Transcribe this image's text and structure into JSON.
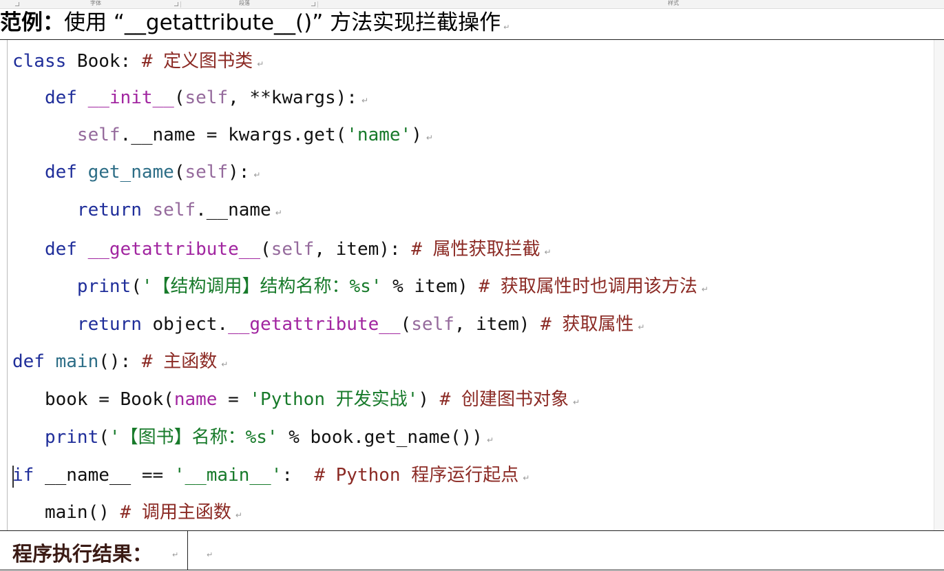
{
  "ribbon": {
    "group_font": "字体",
    "group_paragraph": "段落",
    "group_styles": "样式"
  },
  "heading": {
    "label": "范例",
    "colon": "：",
    "text": "使用 “__getattribute__()” 方法实现拦截操作"
  },
  "paragraph_mark": "↵",
  "code_lines": [
    [
      {
        "t": "class",
        "c": "kw"
      },
      {
        "t": " Book: "
      },
      {
        "t": "# ",
        "c": "cm"
      },
      {
        "t": "定义图书类",
        "c": "cm cn"
      }
    ],
    [
      {
        "t": "   "
      },
      {
        "t": "def",
        "c": "kw"
      },
      {
        "t": " "
      },
      {
        "t": "__init__",
        "c": "dunder"
      },
      {
        "t": "("
      },
      {
        "t": "self",
        "c": "slf"
      },
      {
        "t": ", **kwargs):"
      }
    ],
    [
      {
        "t": "      "
      },
      {
        "t": "self",
        "c": "slf"
      },
      {
        "t": ".__name = kwargs.get("
      },
      {
        "t": "'name'",
        "c": "str"
      },
      {
        "t": ")"
      }
    ],
    [
      {
        "t": "   "
      },
      {
        "t": "def",
        "c": "kw"
      },
      {
        "t": " "
      },
      {
        "t": "get_name",
        "c": "fn"
      },
      {
        "t": "("
      },
      {
        "t": "self",
        "c": "slf"
      },
      {
        "t": "):"
      }
    ],
    [
      {
        "t": "      "
      },
      {
        "t": "return",
        "c": "kw"
      },
      {
        "t": " "
      },
      {
        "t": "self",
        "c": "slf"
      },
      {
        "t": ".__name"
      }
    ],
    [
      {
        "t": "   "
      },
      {
        "t": "def",
        "c": "kw"
      },
      {
        "t": " "
      },
      {
        "t": "__getattribute__",
        "c": "dunder"
      },
      {
        "t": "("
      },
      {
        "t": "self",
        "c": "slf"
      },
      {
        "t": ", item): "
      },
      {
        "t": "# ",
        "c": "cm"
      },
      {
        "t": "属性获取拦截",
        "c": "cm cn"
      }
    ],
    [
      {
        "t": "      "
      },
      {
        "t": "print",
        "c": "kw"
      },
      {
        "t": "("
      },
      {
        "t": "'",
        "c": "str"
      },
      {
        "t": "【结构调用】结构名称：",
        "c": "str cn"
      },
      {
        "t": "%s'",
        "c": "str"
      },
      {
        "t": " % item) "
      },
      {
        "t": "# ",
        "c": "cm"
      },
      {
        "t": "获取属性时也调用该方法",
        "c": "cm cn"
      }
    ],
    [
      {
        "t": "      "
      },
      {
        "t": "return",
        "c": "kw"
      },
      {
        "t": " object."
      },
      {
        "t": "__getattribute__",
        "c": "dunder"
      },
      {
        "t": "("
      },
      {
        "t": "self",
        "c": "slf"
      },
      {
        "t": ", item) "
      },
      {
        "t": "# ",
        "c": "cm"
      },
      {
        "t": "获取属性",
        "c": "cm cn"
      }
    ],
    [
      {
        "t": "def",
        "c": "kw"
      },
      {
        "t": " "
      },
      {
        "t": "main",
        "c": "fn"
      },
      {
        "t": "(): "
      },
      {
        "t": "# ",
        "c": "cm"
      },
      {
        "t": "主函数",
        "c": "cm cn"
      }
    ],
    [
      {
        "t": "   book = Book("
      },
      {
        "t": "name",
        "c": "dunder"
      },
      {
        "t": " = "
      },
      {
        "t": "'Python ",
        "c": "str"
      },
      {
        "t": "开发实战",
        "c": "str cn"
      },
      {
        "t": "'",
        "c": "str"
      },
      {
        "t": ") "
      },
      {
        "t": "# ",
        "c": "cm"
      },
      {
        "t": "创建图书对象",
        "c": "cm cn"
      }
    ],
    [
      {
        "t": "   "
      },
      {
        "t": "print",
        "c": "kw"
      },
      {
        "t": "("
      },
      {
        "t": "'",
        "c": "str"
      },
      {
        "t": "【图书】名称：",
        "c": "str cn"
      },
      {
        "t": "%s'",
        "c": "str"
      },
      {
        "t": " % book.get_name())"
      }
    ],
    [
      {
        "t": "if",
        "c": "kw"
      },
      {
        "t": " __name__ == "
      },
      {
        "t": "'__main__'",
        "c": "str"
      },
      {
        "t": ":  "
      },
      {
        "t": "# Python ",
        "c": "cm"
      },
      {
        "t": "程序运行起点",
        "c": "cm cn"
      }
    ],
    [
      {
        "t": "   main() "
      },
      {
        "t": "# ",
        "c": "cm"
      },
      {
        "t": "调用主函数",
        "c": "cm cn"
      }
    ]
  ],
  "result": {
    "label": "程序执行结果："
  },
  "colors": {
    "keyword": "#1f2e9a",
    "function": "#2c6d86",
    "dunder": "#a125a0",
    "self": "#956a9c",
    "string": "#177a2a",
    "comment": "#8b2a24"
  }
}
